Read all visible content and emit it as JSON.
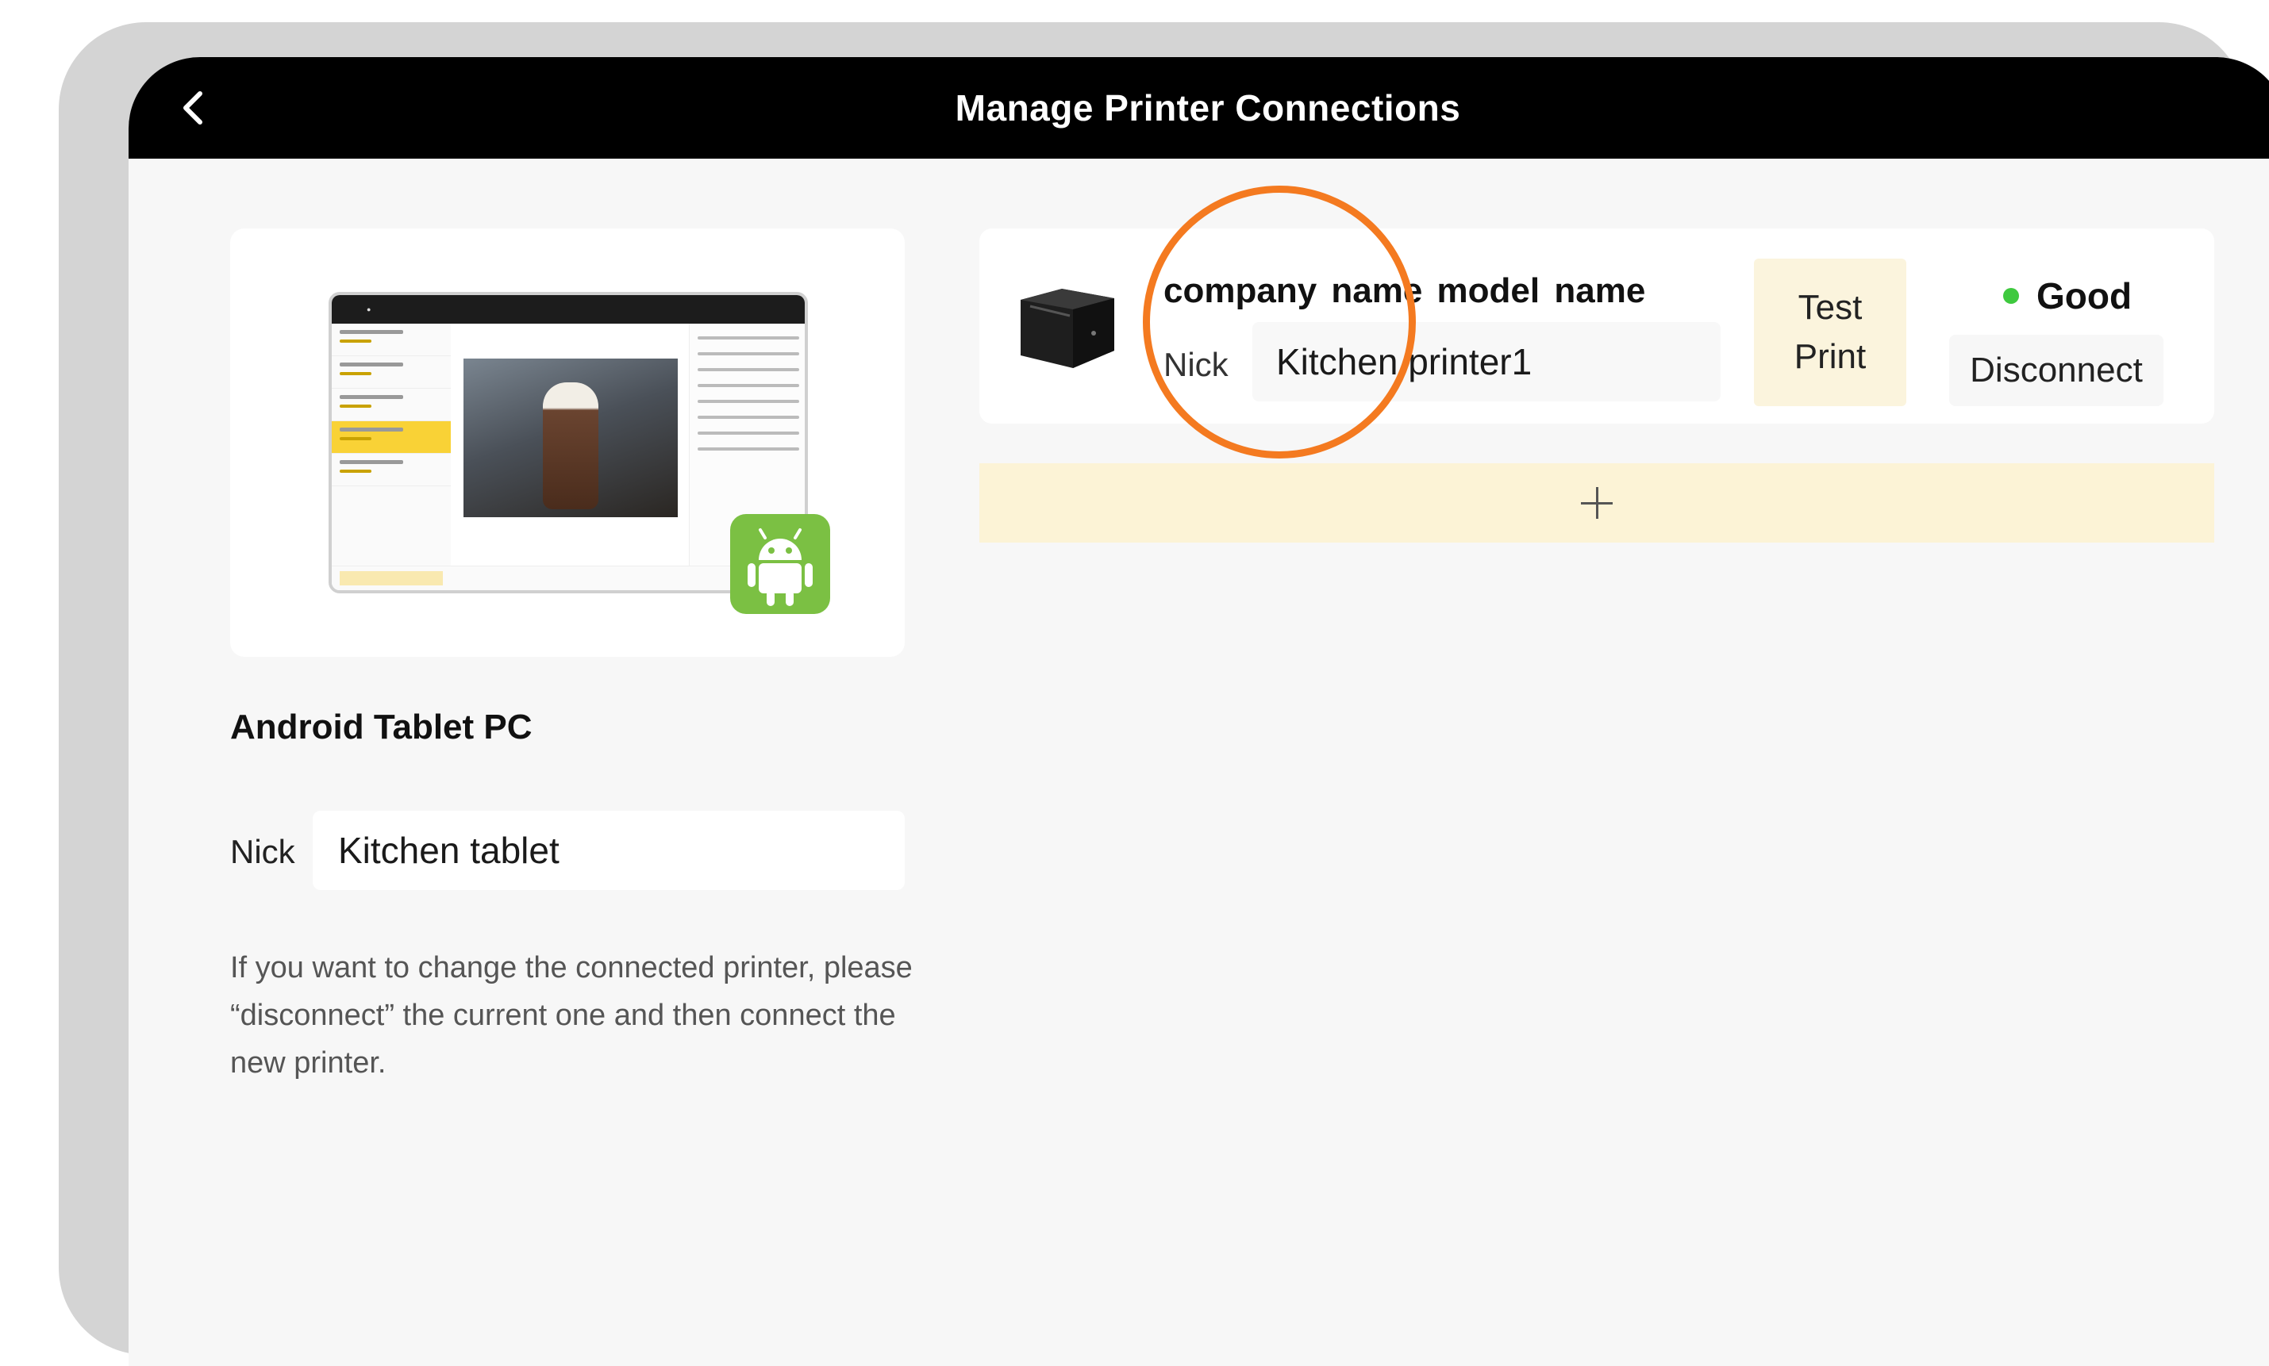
{
  "header": {
    "title": "Manage Printer Connections",
    "back_icon": "chevron-left-icon"
  },
  "tablet": {
    "section_title": "Android Tablet PC",
    "nick_label": "Nick",
    "nick_value": "Kitchen tablet",
    "badge_icon": "android-icon",
    "hint": "If you want to change the connected printer, please “disconnect” the current one and then connect the new printer."
  },
  "printer": {
    "name": "company name  model name",
    "nick_label": "Nick",
    "nick_value": "Kitchen printer1",
    "test_print_line1": "Test",
    "test_print_line2": "Print",
    "status_label": "Good",
    "status_color": "#3ec93e",
    "disconnect_label": "Disconnect",
    "icon": "printer-icon"
  },
  "add_printer": {
    "icon": "plus-icon"
  },
  "colors": {
    "header_bg": "#000000",
    "accent_ring": "#f47a20",
    "test_print_bg": "#fbf4dd",
    "add_bar_bg": "#fcf3d6",
    "android_green": "#7bc043"
  }
}
